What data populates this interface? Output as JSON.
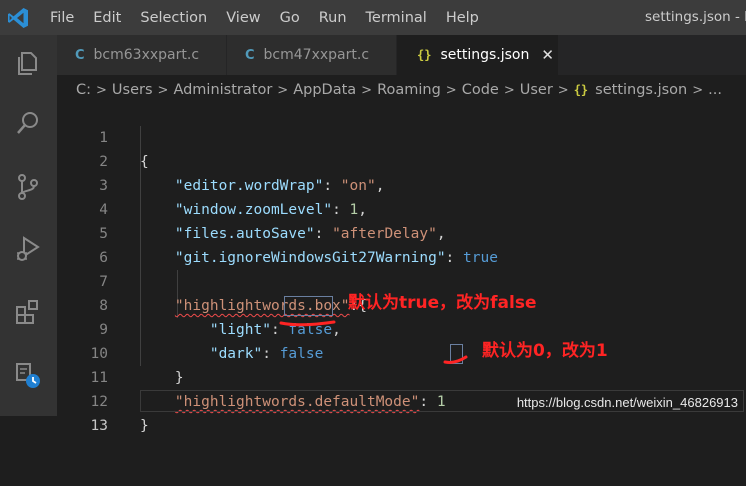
{
  "menu": [
    "File",
    "Edit",
    "Selection",
    "View",
    "Go",
    "Run",
    "Terminal",
    "Help"
  ],
  "window_title": "settings.json - li",
  "tabs": [
    {
      "label": "bcm63xxpart.c",
      "icon": "C",
      "active": false
    },
    {
      "label": "bcm47xxpart.c",
      "icon": "C",
      "active": false
    },
    {
      "label": "settings.json",
      "icon": "{}",
      "active": true,
      "close": "✕"
    }
  ],
  "breadcrumbs": [
    "C:",
    "Users",
    "Administrator",
    "AppData",
    "Roaming",
    "Code",
    "User",
    "settings.json",
    "..."
  ],
  "breadcrumb_sep": ">",
  "json_icon": "{}",
  "editor": {
    "line_numbers": [
      "1",
      "2",
      "3",
      "4",
      "5",
      "6",
      "7",
      "8",
      "9",
      "10",
      "11",
      "12",
      "13"
    ],
    "brace_open": "{",
    "brace_close": "}",
    "l2_key": "\"editor.wordWrap\"",
    "l2_val": "\"on\"",
    "l3_key": "\"window.zoomLevel\"",
    "l3_val": "1",
    "l4_key": "\"files.autoSave\"",
    "l4_val": "\"afterDelay\"",
    "l5_key": "\"git.ignoreWindowsGit27Warning\"",
    "l5_val": "true",
    "l7_key": "\"highlightwords.box\"",
    "l8_key": "\"light\"",
    "l8_val": "false",
    "l9_key": "\"dark\"",
    "l9_val": "false",
    "l11_key": "\"highlightwords.defaultMode\"",
    "l11_val": "1"
  },
  "annotations": {
    "dark": "默认为true，改为false",
    "mode": "默认为0，改为1"
  },
  "watermark": "https://blog.csdn.net/weixin_46826913",
  "colors": {
    "annotation": "#ff2424",
    "accent": "#007acc"
  }
}
